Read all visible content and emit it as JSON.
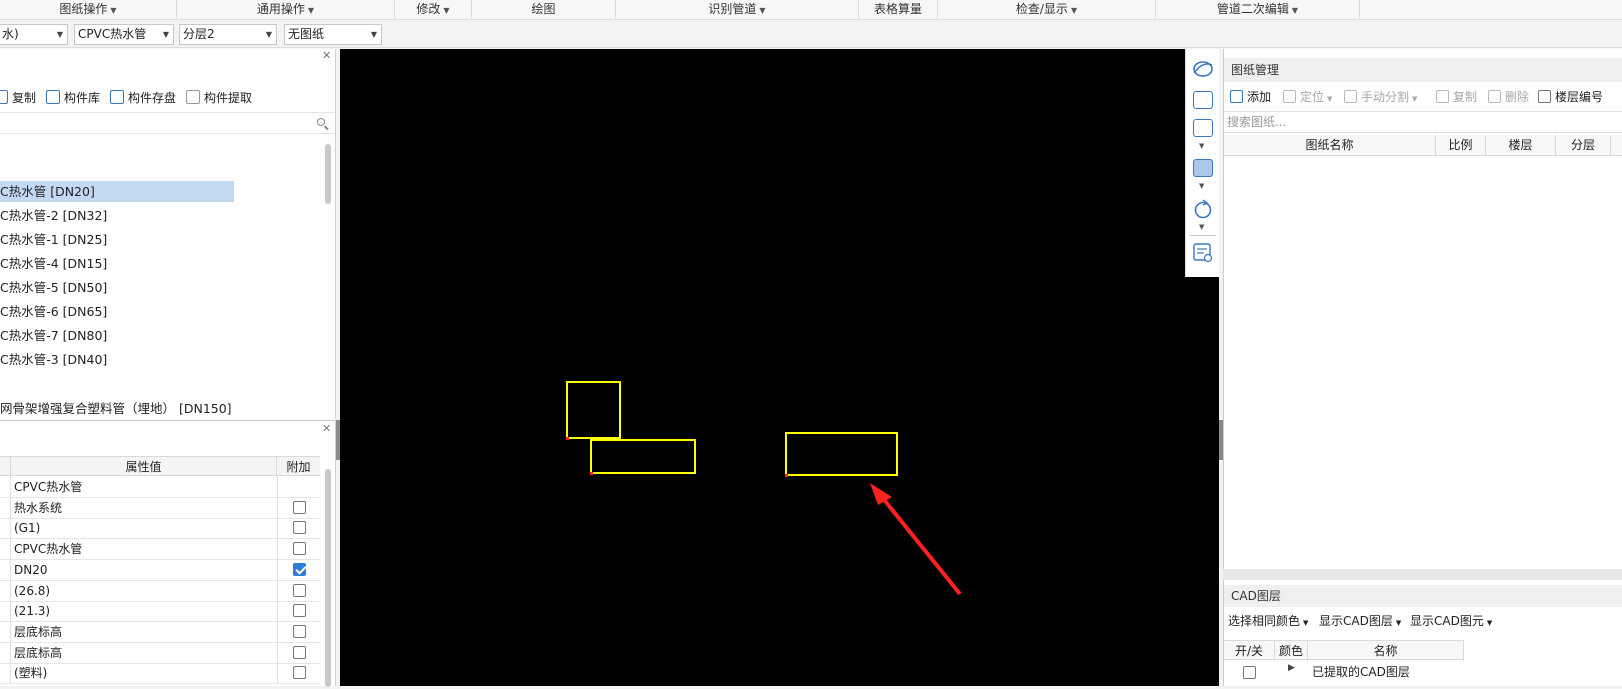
{
  "ribbon": {
    "groups": [
      {
        "label": "图纸操作",
        "has_menu": true
      },
      {
        "label": "通用操作",
        "has_menu": true
      },
      {
        "label": "修改",
        "has_menu": true
      },
      {
        "label": "绘图",
        "has_menu": false
      },
      {
        "label": "识别管道",
        "has_menu": true
      },
      {
        "label": "表格算量",
        "has_menu": false
      },
      {
        "label": "检查/显示",
        "has_menu": true
      },
      {
        "label": "管道二次编辑",
        "has_menu": true
      }
    ]
  },
  "selectors": {
    "system": "水)",
    "component": "CPVC热水管",
    "layer": "分层2",
    "drawing": "无图纸"
  },
  "component_toolbar": {
    "copy": "复制",
    "library": "构件库",
    "save": "构件存盘",
    "extract": "构件提取"
  },
  "component_tree": {
    "items": [
      {
        "label": "C热水管 [DN20]",
        "selected": true
      },
      {
        "label": "C热水管-2 [DN32]",
        "selected": false
      },
      {
        "label": "C热水管-1 [DN25]",
        "selected": false
      },
      {
        "label": "C热水管-4 [DN15]",
        "selected": false
      },
      {
        "label": "C热水管-5 [DN50]",
        "selected": false
      },
      {
        "label": "C热水管-6 [DN65]",
        "selected": false
      },
      {
        "label": "C热水管-7 [DN80]",
        "selected": false
      },
      {
        "label": "C热水管-3 [DN40]",
        "selected": false
      }
    ],
    "extra_item": "网骨架增强复合塑料管（埋地） [DN150]"
  },
  "properties": {
    "headers": {
      "value": "属性值",
      "attach": "附加"
    },
    "rows": [
      {
        "value": "CPVC热水管",
        "has_checkbox": false,
        "checked": false
      },
      {
        "value": "热水系统",
        "has_checkbox": true,
        "checked": false
      },
      {
        "value": "(G1)",
        "has_checkbox": true,
        "checked": false
      },
      {
        "value": "CPVC热水管",
        "has_checkbox": true,
        "checked": false
      },
      {
        "value": "DN20",
        "has_checkbox": true,
        "checked": true
      },
      {
        "value": "(26.8)",
        "has_checkbox": true,
        "checked": false
      },
      {
        "value": "(21.3)",
        "has_checkbox": true,
        "checked": false
      },
      {
        "value": "层底标高",
        "has_checkbox": true,
        "checked": false
      },
      {
        "value": "层底标高",
        "has_checkbox": true,
        "checked": false
      },
      {
        "value": "(塑料)",
        "has_checkbox": true,
        "checked": false
      }
    ]
  },
  "drawing_manager": {
    "title": "图纸管理",
    "toolbar": {
      "add": "添加",
      "locate": "定位",
      "split": "手动分割",
      "copy": "复制",
      "delete": "删除",
      "floor_number": "楼层编号"
    },
    "search_placeholder": "搜索图纸...",
    "columns": [
      "图纸名称",
      "比例",
      "楼层",
      "分层"
    ]
  },
  "cad_layers": {
    "title": "CAD图层",
    "toolbar": {
      "same_color": "选择相同颜色",
      "show_layer": "显示CAD图层",
      "show_element": "显示CAD图元"
    },
    "columns": [
      "开/关",
      "颜色",
      "名称"
    ],
    "rows": [
      {
        "name": "已提取的CAD图层"
      }
    ]
  },
  "colors": {
    "canvas_bg": "#000000",
    "shape_stroke": "#ffff00",
    "arrow": "#ff2020",
    "selection": "#c3d9f3",
    "accent": "#3a76c4"
  }
}
